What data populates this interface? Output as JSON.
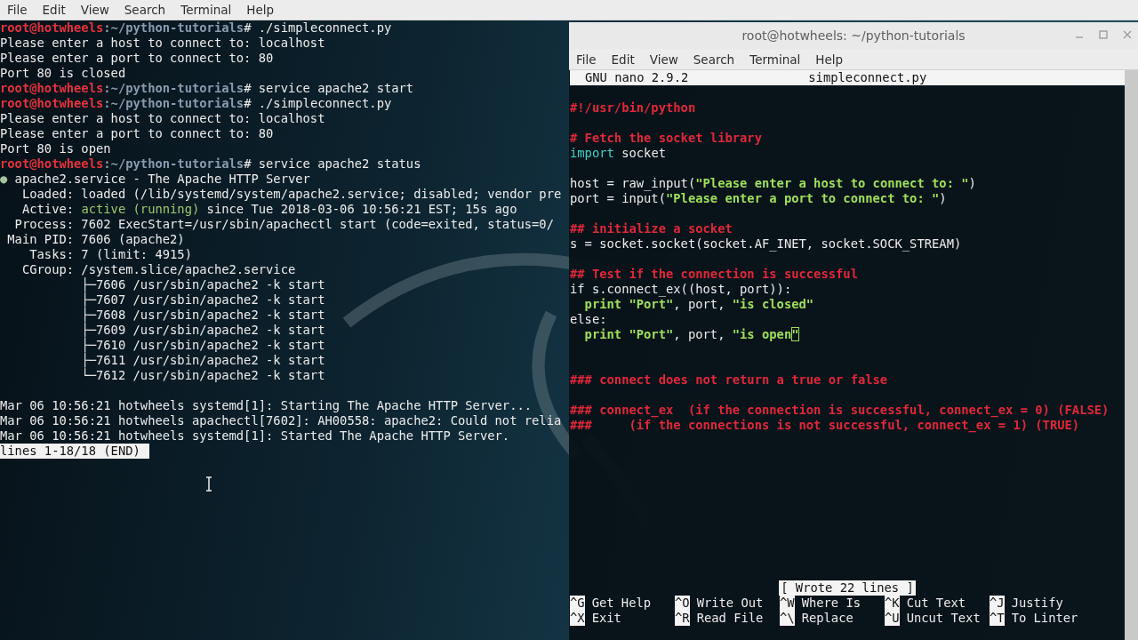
{
  "left_terminal": {
    "menu": [
      "File",
      "Edit",
      "View",
      "Search",
      "Terminal",
      "Help"
    ],
    "lines": [
      {
        "kind": "line",
        "segments": [
          {
            "text": "root@hotwheels",
            "kind": "user"
          },
          {
            "text": ":~/python-tutorials",
            "kind": "path"
          },
          {
            "text": "# ./simpleconnect.py",
            "kind": "plain"
          }
        ]
      },
      {
        "kind": "line",
        "segments": [
          {
            "text": "Please enter a host to connect to: localhost",
            "kind": "plain"
          }
        ]
      },
      {
        "kind": "line",
        "segments": [
          {
            "text": "Please enter a port to connect to: 80",
            "kind": "plain"
          }
        ]
      },
      {
        "kind": "line",
        "segments": [
          {
            "text": "Port 80 is closed",
            "kind": "plain"
          }
        ]
      },
      {
        "kind": "line",
        "segments": [
          {
            "text": "root@hotwheels",
            "kind": "user"
          },
          {
            "text": ":~/python-tutorials",
            "kind": "path"
          },
          {
            "text": "# service apache2 start",
            "kind": "plain"
          }
        ]
      },
      {
        "kind": "line",
        "segments": [
          {
            "text": "root@hotwheels",
            "kind": "user"
          },
          {
            "text": ":~/python-tutorials",
            "kind": "path"
          },
          {
            "text": "# ./simpleconnect.py",
            "kind": "plain"
          }
        ]
      },
      {
        "kind": "line",
        "segments": [
          {
            "text": "Please enter a host to connect to: localhost",
            "kind": "plain"
          }
        ]
      },
      {
        "kind": "line",
        "segments": [
          {
            "text": "Please enter a port to connect to: 80",
            "kind": "plain"
          }
        ]
      },
      {
        "kind": "line",
        "segments": [
          {
            "text": "Port 80 is open",
            "kind": "plain"
          }
        ]
      },
      {
        "kind": "line",
        "segments": [
          {
            "text": "root@hotwheels",
            "kind": "user"
          },
          {
            "text": ":~/python-tutorials",
            "kind": "path"
          },
          {
            "text": "# service apache2 status",
            "kind": "plain"
          }
        ]
      },
      {
        "kind": "line",
        "segments": [
          {
            "text": "●",
            "kind": "bullet"
          },
          {
            "text": " apache2.service - The Apache HTTP Server",
            "kind": "plain"
          }
        ]
      },
      {
        "kind": "line",
        "segments": [
          {
            "text": "   Loaded: loaded (/lib/systemd/system/apache2.service; disabled; vendor pre",
            "kind": "plain"
          }
        ]
      },
      {
        "kind": "line",
        "segments": [
          {
            "text": "   Active: ",
            "kind": "plain"
          },
          {
            "text": "active (running)",
            "kind": "green"
          },
          {
            "text": " since Tue 2018-03-06 10:56:21 EST; 15s ago",
            "kind": "plain"
          }
        ]
      },
      {
        "kind": "line",
        "segments": [
          {
            "text": "  Process: 7602 ExecStart=/usr/sbin/apachectl start (code=exited, status=0/",
            "kind": "plain"
          }
        ]
      },
      {
        "kind": "line",
        "segments": [
          {
            "text": " Main PID: 7606 (apache2)",
            "kind": "plain"
          }
        ]
      },
      {
        "kind": "line",
        "segments": [
          {
            "text": "    Tasks: 7 (limit: 4915)",
            "kind": "plain"
          }
        ]
      },
      {
        "kind": "line",
        "segments": [
          {
            "text": "   CGroup: /system.slice/apache2.service",
            "kind": "plain"
          }
        ]
      },
      {
        "kind": "line",
        "segments": [
          {
            "text": "           ├─7606 /usr/sbin/apache2 -k start",
            "kind": "plain"
          }
        ]
      },
      {
        "kind": "line",
        "segments": [
          {
            "text": "           ├─7607 /usr/sbin/apache2 -k start",
            "kind": "plain"
          }
        ]
      },
      {
        "kind": "line",
        "segments": [
          {
            "text": "           ├─7608 /usr/sbin/apache2 -k start",
            "kind": "plain"
          }
        ]
      },
      {
        "kind": "line",
        "segments": [
          {
            "text": "           ├─7609 /usr/sbin/apache2 -k start",
            "kind": "plain"
          }
        ]
      },
      {
        "kind": "line",
        "segments": [
          {
            "text": "           ├─7610 /usr/sbin/apache2 -k start",
            "kind": "plain"
          }
        ]
      },
      {
        "kind": "line",
        "segments": [
          {
            "text": "           ├─7611 /usr/sbin/apache2 -k start",
            "kind": "plain"
          }
        ]
      },
      {
        "kind": "line",
        "segments": [
          {
            "text": "           └─7612 /usr/sbin/apache2 -k start",
            "kind": "plain"
          }
        ]
      },
      {
        "kind": "blank"
      },
      {
        "kind": "line",
        "segments": [
          {
            "text": "Mar 06 10:56:21 hotwheels systemd[1]: Starting The Apache HTTP Server...",
            "kind": "plain"
          }
        ]
      },
      {
        "kind": "line",
        "segments": [
          {
            "text": "Mar 06 10:56:21 hotwheels apachectl[7602]: AH00558: apache2: Could not relia",
            "kind": "plain"
          }
        ]
      },
      {
        "kind": "line",
        "segments": [
          {
            "text": "Mar 06 10:56:21 hotwheels systemd[1]: Started The Apache HTTP Server.",
            "kind": "plain"
          }
        ]
      }
    ],
    "status": "lines 1-18/18 (END)"
  },
  "right_window": {
    "title": "root@hotwheels: ~/python-tutorials",
    "menu": [
      "File",
      "Edit",
      "View",
      "Search",
      "Terminal",
      "Help"
    ],
    "nano": {
      "version": "GNU nano 2.9.2",
      "filename": "simpleconnect.py",
      "lines": [
        {
          "kind": "blank"
        },
        {
          "kind": "line",
          "segments": [
            {
              "text": "#!/usr/bin/python",
              "kind": "comment"
            }
          ]
        },
        {
          "kind": "blank"
        },
        {
          "kind": "line",
          "segments": [
            {
              "text": "# Fetch the socket library",
              "kind": "comment"
            }
          ]
        },
        {
          "kind": "line",
          "segments": [
            {
              "text": "import",
              "kind": "keyword"
            },
            {
              "text": " socket",
              "kind": "plain"
            }
          ]
        },
        {
          "kind": "blank"
        },
        {
          "kind": "line",
          "segments": [
            {
              "text": "host = raw_input(",
              "kind": "plain"
            },
            {
              "text": "\"Please enter a host to connect to: \"",
              "kind": "string"
            },
            {
              "text": ")",
              "kind": "plain"
            }
          ]
        },
        {
          "kind": "line",
          "segments": [
            {
              "text": "port = input(",
              "kind": "plain"
            },
            {
              "text": "\"Please enter a port to connect to: \"",
              "kind": "string"
            },
            {
              "text": ")",
              "kind": "plain"
            }
          ]
        },
        {
          "kind": "blank"
        },
        {
          "kind": "line",
          "segments": [
            {
              "text": "## initialize a socket",
              "kind": "comment"
            }
          ]
        },
        {
          "kind": "line",
          "segments": [
            {
              "text": "s = socket.socket(socket.AF_INET, socket.SOCK_STREAM)",
              "kind": "plain"
            }
          ]
        },
        {
          "kind": "blank"
        },
        {
          "kind": "line",
          "segments": [
            {
              "text": "## Test if the connection is successful",
              "kind": "comment"
            }
          ]
        },
        {
          "kind": "line",
          "segments": [
            {
              "text": "if s.connect_ex((host, port)):",
              "kind": "plain"
            }
          ]
        },
        {
          "kind": "line",
          "segments": [
            {
              "text": "  print \"Port\"",
              "kind": "string"
            },
            {
              "text": ", port, ",
              "kind": "plain"
            },
            {
              "text": "\"is closed\"",
              "kind": "string"
            }
          ]
        },
        {
          "kind": "line",
          "segments": [
            {
              "text": "else:",
              "kind": "plain"
            }
          ]
        },
        {
          "kind": "line",
          "segments": [
            {
              "text": "  print \"Port\"",
              "kind": "string"
            },
            {
              "text": ", port, ",
              "kind": "plain"
            },
            {
              "text": "\"is open",
              "kind": "string"
            },
            {
              "text": "\"",
              "kind": "cursor"
            }
          ]
        },
        {
          "kind": "blank"
        },
        {
          "kind": "blank"
        },
        {
          "kind": "line",
          "segments": [
            {
              "text": "### connect does not return a true or false",
              "kind": "comment"
            }
          ]
        },
        {
          "kind": "blank"
        },
        {
          "kind": "line",
          "segments": [
            {
              "text": "### connect_ex  (if the connection is successful, connect_ex = 0) (FALSE)",
              "kind": "comment"
            }
          ]
        },
        {
          "kind": "line",
          "segments": [
            {
              "text": "###     (if the connections is not successful, connect_ex = 1) (TRUE)",
              "kind": "comment"
            }
          ]
        }
      ],
      "message": "[ Wrote 22 lines ]",
      "shortcuts": [
        {
          "key": "^G",
          "label": "Get Help"
        },
        {
          "key": "^O",
          "label": "Write Out"
        },
        {
          "key": "^W",
          "label": "Where Is"
        },
        {
          "key": "^K",
          "label": "Cut Text"
        },
        {
          "key": "^J",
          "label": "Justify"
        },
        {
          "key": "^X",
          "label": "Exit"
        },
        {
          "key": "^R",
          "label": "Read File"
        },
        {
          "key": "^\\",
          "label": "Replace"
        },
        {
          "key": "^U",
          "label": "Uncut Text"
        },
        {
          "key": "^T",
          "label": "To Linter"
        }
      ]
    }
  }
}
